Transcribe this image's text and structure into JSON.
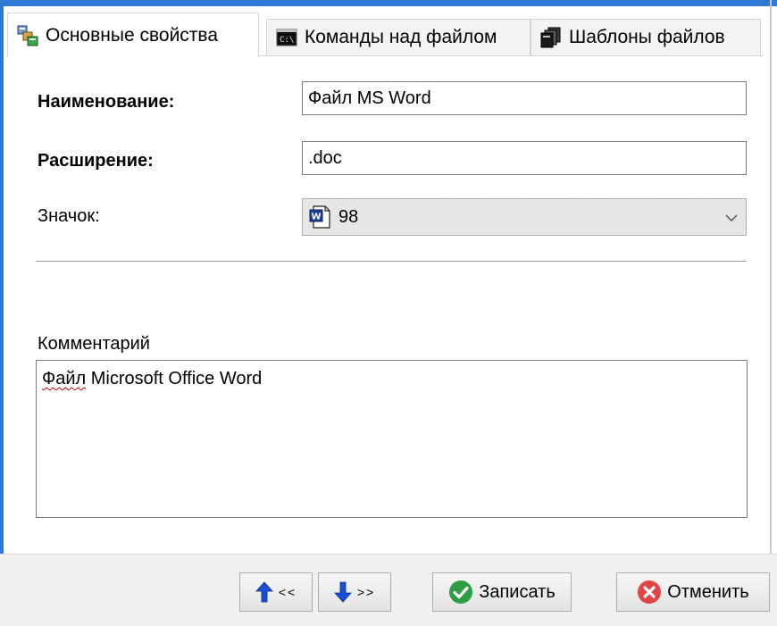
{
  "tabs": [
    {
      "label": "Основные свойства",
      "icon": "properties-icon",
      "active": true
    },
    {
      "label": "Команды над файлом",
      "icon": "console-icon",
      "active": false
    },
    {
      "label": "Шаблоны файлов",
      "icon": "file-templates-icon",
      "active": false
    }
  ],
  "form": {
    "name_label": "Наименование:",
    "name_value": "Файл MS Word",
    "ext_label": "Расширение:",
    "ext_value": ".doc",
    "icon_label": "Значок:",
    "icon_value": "98",
    "icon_name": "word-doc-icon",
    "comment_label": "Комментарий",
    "comment_word1": "Файл",
    "comment_rest": " Microsoft Office Word"
  },
  "footer": {
    "prev_label": "<<",
    "next_label": ">>",
    "save_label": "Записать",
    "cancel_label": "Отменить"
  },
  "colors": {
    "accent": "#2b7bd6",
    "save_green": "#2e9e44",
    "cancel_red": "#e04545"
  }
}
